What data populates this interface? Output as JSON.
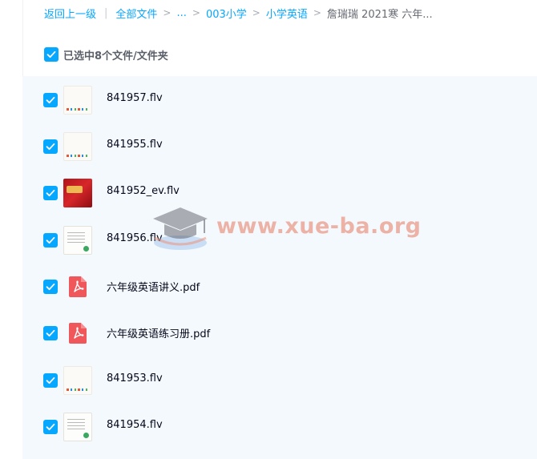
{
  "breadcrumb": {
    "back": "返回上一级",
    "separator_bar": "|",
    "all_files": "全部文件",
    "ellipsis": "...",
    "separator": ">",
    "folder1": "003小学",
    "folder2": "小学英语",
    "current": "詹瑞瑞 2021寒 六年..."
  },
  "selection": {
    "label": "已选中8个文件/文件夹",
    "checked": true
  },
  "files": [
    {
      "name": "841957.flv",
      "type": "video",
      "thumb": "white",
      "checked": true
    },
    {
      "name": "841955.flv",
      "type": "video",
      "thumb": "white",
      "checked": true
    },
    {
      "name": "841952_ev.flv",
      "type": "video",
      "thumb": "red",
      "checked": true
    },
    {
      "name": "841956.flv",
      "type": "video",
      "thumb": "doc",
      "checked": true
    },
    {
      "name": "六年级英语讲义.pdf",
      "type": "pdf",
      "thumb": "pdf-icon",
      "checked": true
    },
    {
      "name": "六年级英语练习册.pdf",
      "type": "pdf",
      "thumb": "pdf-icon",
      "checked": true
    },
    {
      "name": "841953.flv",
      "type": "video",
      "thumb": "white",
      "checked": true
    },
    {
      "name": "841954.flv",
      "type": "video",
      "thumb": "doc",
      "checked": true
    }
  ],
  "watermark": {
    "text": "www.xue-ba.org",
    "icon": "graduation-cap-icon"
  },
  "colors": {
    "accent": "#06a7ff",
    "pdf": "#f0575a",
    "list_background": "#f4f9fd"
  }
}
